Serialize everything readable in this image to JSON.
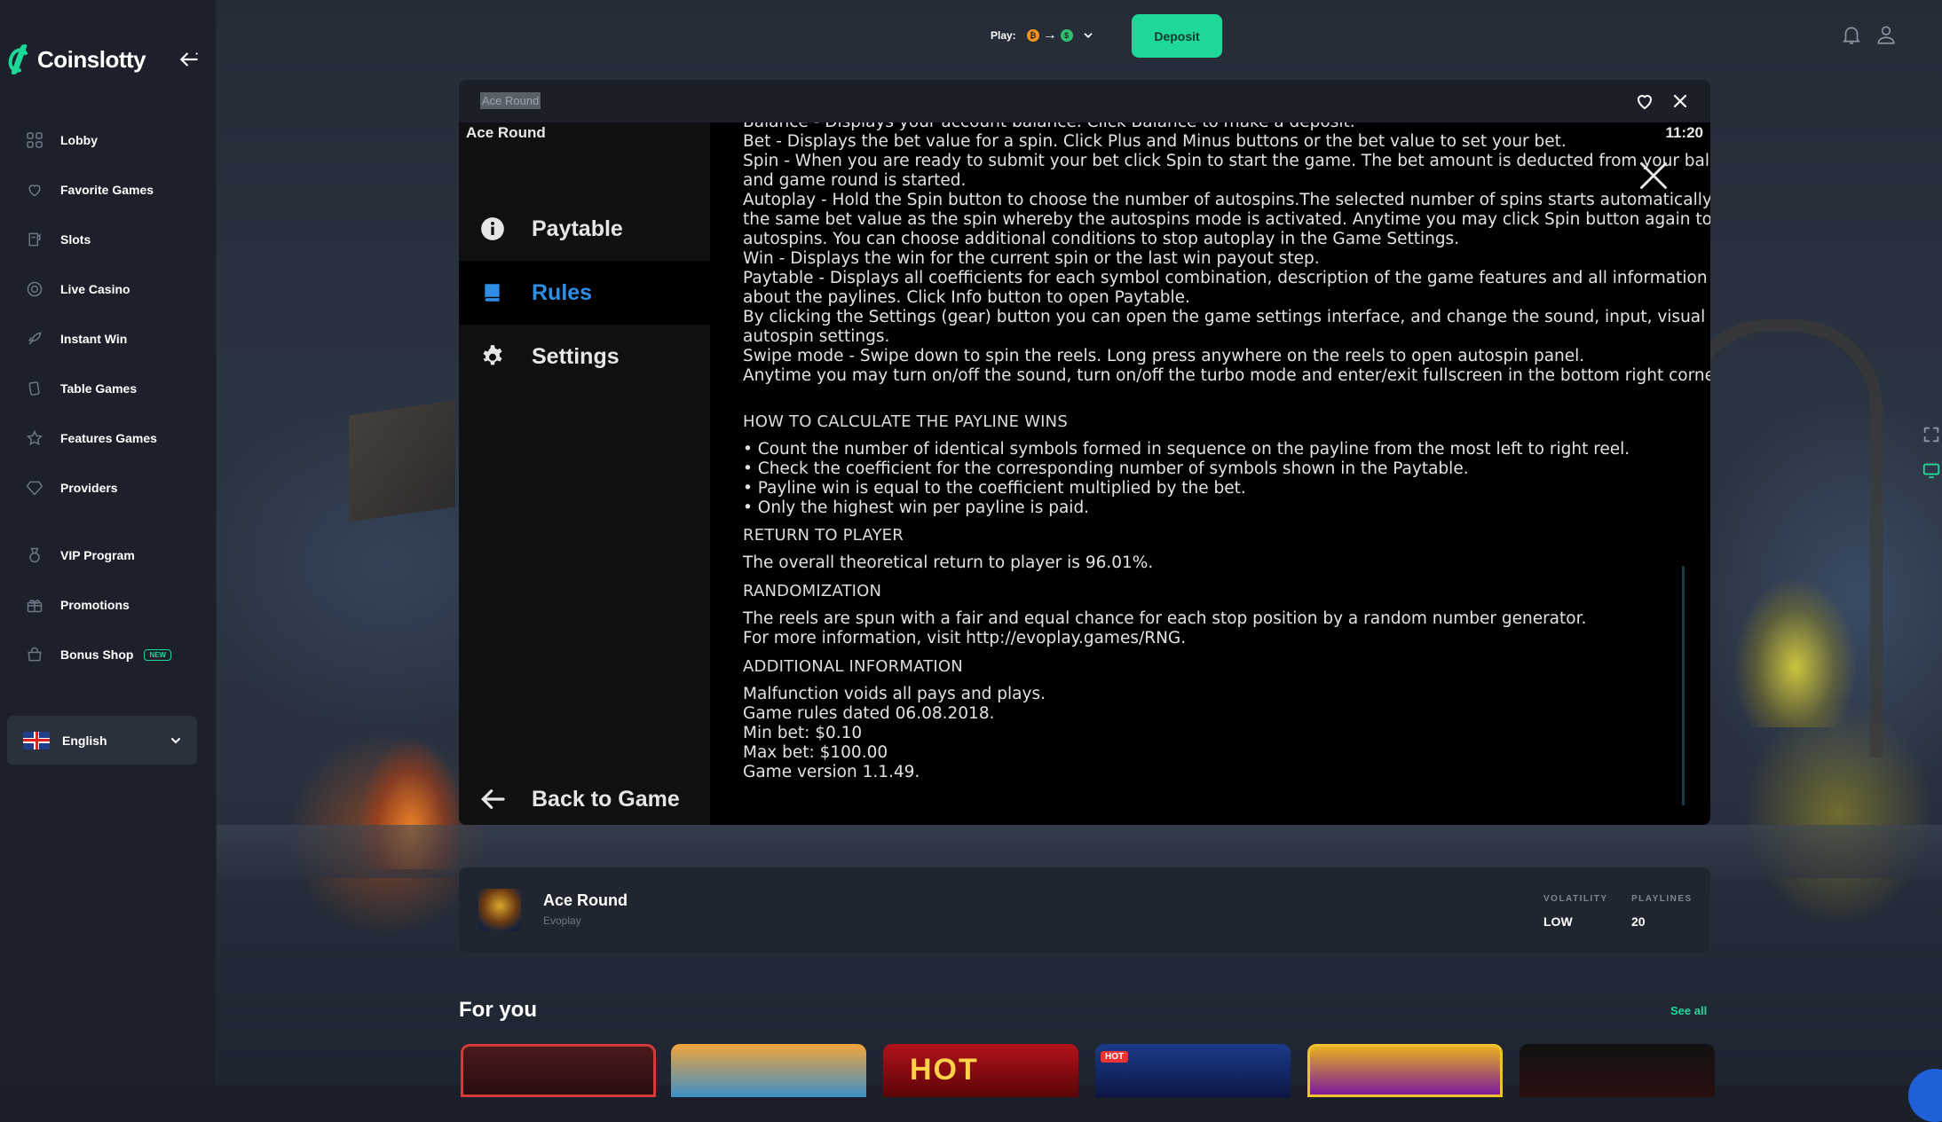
{
  "brand": {
    "name": "Coinslotty"
  },
  "sidebar": {
    "items": [
      {
        "label": "Lobby",
        "icon": "grid-icon"
      },
      {
        "label": "Favorite Games",
        "icon": "heart-icon"
      },
      {
        "label": "Slots",
        "icon": "slot-machine-icon"
      },
      {
        "label": "Live Casino",
        "icon": "chip-icon"
      },
      {
        "label": "Instant Win",
        "icon": "rocket-icon"
      },
      {
        "label": "Table Games",
        "icon": "cards-icon"
      },
      {
        "label": "Features Games",
        "icon": "star-icon"
      },
      {
        "label": "Providers",
        "icon": "diamond-icon"
      },
      {
        "label": "VIP Program",
        "icon": "medal-icon"
      },
      {
        "label": "Promotions",
        "icon": "gift-icon"
      },
      {
        "label": "Bonus Shop",
        "icon": "shop-icon",
        "badge": "NEW"
      }
    ],
    "language": {
      "label": "English"
    }
  },
  "topbar": {
    "play_label": "Play:",
    "deposit_label": "Deposit"
  },
  "frame": {
    "title": "Ace Round"
  },
  "game": {
    "title": "Ace Round",
    "clock": "11:20",
    "menu": [
      {
        "label": "Paytable",
        "active": false
      },
      {
        "label": "Rules",
        "active": true
      },
      {
        "label": "Settings",
        "active": false
      }
    ],
    "back_label": "Back to Game",
    "rules": {
      "top_lines": [
        "Balance - Displays your account balance. Click Balance to make a deposit.",
        "Bet - Displays the bet value for a spin. Click Plus and Minus buttons or the bet value to set your bet.",
        "Spin - When you are ready to submit your bet click Spin to start the game. The bet amount is deducted from your balance",
        "and game round is started.",
        "Autoplay - Hold the Spin button to choose the number of autospins.The selected number of spins starts automatically with",
        "the same bet value as the spin whereby the autospins mode is activated. Anytime you may click Spin button again to stop",
        "autospins. You can choose additional conditions to stop autoplay in the Game Settings.",
        "Win - Displays the win for the current spin or the last win payout step.",
        "Paytable - Displays all coefficients for each symbol combination, description of the game features and all information",
        "about the paylines. Click Info button to open Paytable.",
        "By clicking the Settings (gear) button you can open the game settings interface, and change the sound, input, visual and",
        "autospin settings.",
        "Swipe mode - Swipe down to spin the reels. Long press anywhere on the reels to open autospin panel.",
        "Anytime you may turn on/off the sound, turn on/off the turbo mode and enter/exit fullscreen in the bottom right corner."
      ],
      "payline_header": "HOW TO CALCULATE THE PAYLINE WINS",
      "payline_lines": [
        "• Count the number of identical symbols formed in sequence on the payline from the most left to right reel.",
        "• Check the coefficient for the corresponding number of symbols shown in the Paytable.",
        "• Payline win is equal to the coefficient multiplied by the bet.",
        "• Only the highest win per payline is paid."
      ],
      "rtp_header": "RETURN TO PLAYER",
      "rtp_lines": [
        "The overall theoretical return to player is 96.01%."
      ],
      "random_header": "RANDOMIZATION",
      "random_lines": [
        "The reels are spun with a fair and equal chance for each stop position by a random number generator.",
        "For more information, visit http://evoplay.games/RNG."
      ],
      "additional_header": "ADDITIONAL INFORMATION",
      "additional_lines": [
        "Malfunction voids all pays and plays.",
        "Game rules dated 06.08.2018.",
        "Min bet: $0.10",
        "Max bet: $100.00",
        "Game version 1.1.49."
      ]
    }
  },
  "game_info": {
    "name": "Ace Round",
    "provider": "Evoplay",
    "volatility_label": "VOLATILITY",
    "volatility_value": "LOW",
    "playlines_label": "PLAYLINES",
    "playlines_value": "20"
  },
  "for_you": {
    "title": "For you",
    "see_all": "See all",
    "thumbs": [
      {
        "text": "",
        "badge": ""
      },
      {
        "text": "",
        "badge": ""
      },
      {
        "text": "HOT",
        "badge": ""
      },
      {
        "text": "",
        "badge": "HOT"
      },
      {
        "text": "",
        "badge": ""
      },
      {
        "text": "",
        "badge": ""
      }
    ]
  },
  "colors": {
    "accent": "#1ed89a",
    "active_menu": "#2e8ee6",
    "sidebar_bg": "#1b202a"
  }
}
